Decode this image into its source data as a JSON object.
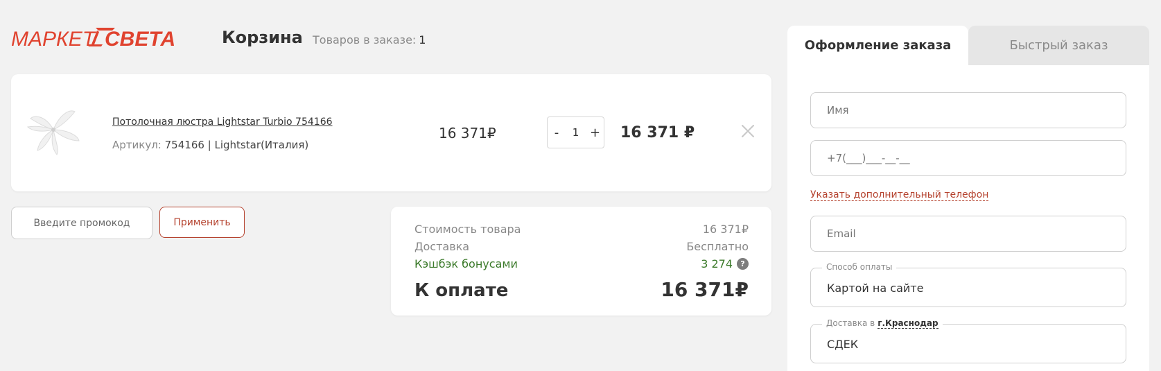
{
  "header": {
    "logo_text_left": "МАРКЕТ",
    "logo_text_right": "СВЕТА",
    "title": "Корзина",
    "order_count_label": "Товаров в заказе:",
    "order_count_value": "1"
  },
  "cart": {
    "items": [
      {
        "name": "Потолочная люстра Lightstar Turbio 754166",
        "article_label": "Артикул:",
        "article_value": "754166 | Lightstar(Италия)",
        "unit_price": "16 371",
        "quantity": "1",
        "decrease_label": "-",
        "increase_label": "+",
        "total_price": "16 371",
        "currency": "₽"
      }
    ]
  },
  "promo": {
    "placeholder": "Введите промокод",
    "apply_label": "Применить"
  },
  "summary": {
    "goods_label": "Стоимость товара",
    "goods_value": "16 371₽",
    "delivery_label": "Доставка",
    "delivery_value": "Бесплатно",
    "cashback_label": "Кэшбэк бонусами",
    "cashback_value": "3 274",
    "help_glyph": "?",
    "total_label": "К оплате",
    "total_value": "16 371₽"
  },
  "checkout": {
    "tabs": [
      {
        "label": "Оформление заказа",
        "active": true
      },
      {
        "label": "Быстрый заказ",
        "active": false
      }
    ],
    "name_placeholder": "Имя",
    "phone_placeholder": "+7(___)___-__-__",
    "extra_phone_label": "Указать дополнительный телефон",
    "email_placeholder": "Email",
    "payment_legend": "Способ оплаты",
    "payment_value": "Картой на сайте",
    "delivery_legend": "Доставка в",
    "delivery_city": "г.Краснодар",
    "delivery_value": "СДЕК"
  },
  "colors": {
    "brand": "#e0432f",
    "accent": "#b5432f",
    "cashback": "#3b7a2a"
  },
  "icons": {
    "remove": "close-icon",
    "help": "question-icon",
    "logo_lamp": "lamp-icon"
  }
}
